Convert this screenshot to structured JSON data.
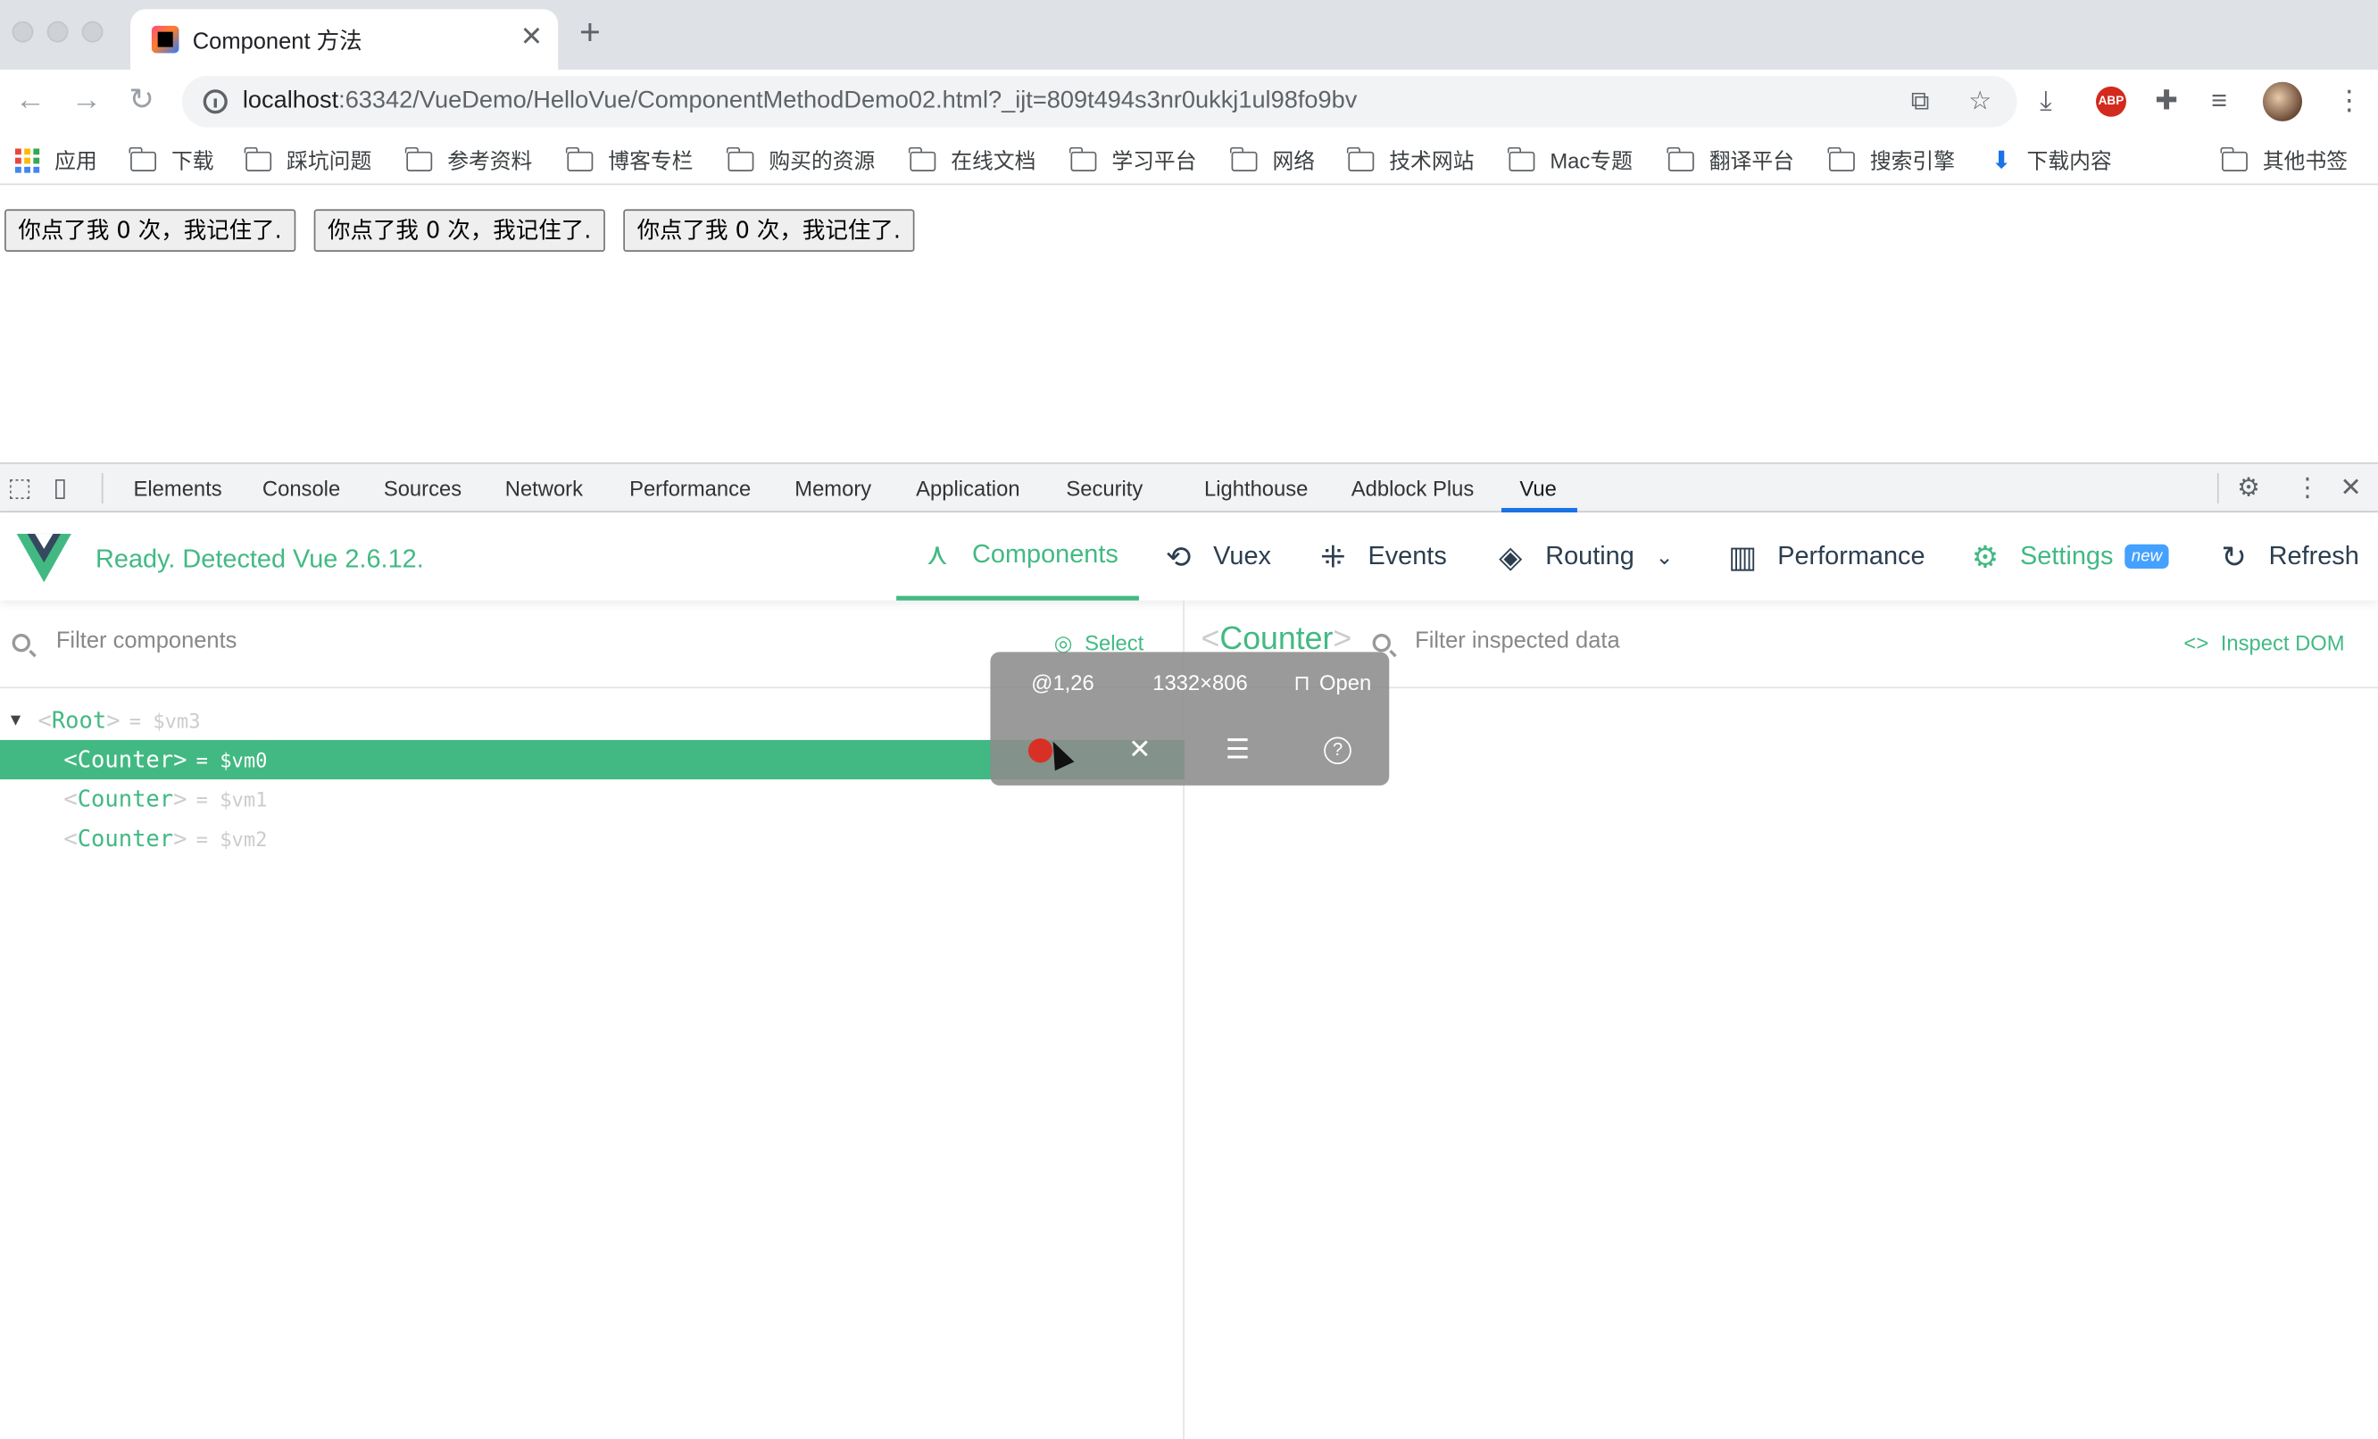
{
  "browser": {
    "tab_title": "Component 方法",
    "url_host": "localhost",
    "url_path": ":63342/VueDemo/HelloVue/ComponentMethodDemo02.html?_ijt=809t494s3nr0ukkj1ul98fo9bv",
    "close_glyph": "✕",
    "new_tab_glyph": "+"
  },
  "bookmarks": [
    {
      "label": "应用",
      "icon": "apps-icon"
    },
    {
      "label": "下载",
      "icon": "folder-icon"
    },
    {
      "label": "踩坑问题",
      "icon": "folder-icon"
    },
    {
      "label": "参考资料",
      "icon": "folder-icon"
    },
    {
      "label": "博客专栏",
      "icon": "folder-icon"
    },
    {
      "label": "购买的资源",
      "icon": "folder-icon"
    },
    {
      "label": "在线文档",
      "icon": "folder-icon"
    },
    {
      "label": "学习平台",
      "icon": "folder-icon"
    },
    {
      "label": "网络",
      "icon": "folder-icon"
    },
    {
      "label": "技术网站",
      "icon": "folder-icon"
    },
    {
      "label": "Mac专题",
      "icon": "folder-icon"
    },
    {
      "label": "翻译平台",
      "icon": "folder-icon"
    },
    {
      "label": "搜索引擎",
      "icon": "folder-icon"
    },
    {
      "label": "下载内容",
      "icon": "download-icon"
    },
    {
      "label": "其他书签",
      "icon": "folder-icon"
    }
  ],
  "page": {
    "buttons": [
      "你点了我 0 次，我记住了.",
      "你点了我 0 次，我记住了.",
      "你点了我 0 次，我记住了."
    ]
  },
  "devtools": {
    "tabs": [
      "Elements",
      "Console",
      "Sources",
      "Network",
      "Performance",
      "Memory",
      "Application",
      "Security",
      "Lighthouse",
      "Adblock Plus",
      "Vue"
    ],
    "active_tab": "Vue"
  },
  "vue": {
    "status": "Ready. Detected Vue 2.6.12.",
    "nav": {
      "components": "Components",
      "vuex": "Vuex",
      "events": "Events",
      "routing": "Routing",
      "performance": "Performance",
      "settings": "Settings",
      "settings_badge": "new",
      "refresh": "Refresh"
    },
    "filter_components_placeholder": "Filter components",
    "select_label": "Select",
    "tree": [
      {
        "tag": "Root",
        "vm": "= $vm3",
        "selected": false
      },
      {
        "tag": "Counter",
        "vm": "= $vm0",
        "selected": true
      },
      {
        "tag": "Counter",
        "vm": "= $vm1",
        "selected": false
      },
      {
        "tag": "Counter",
        "vm": "= $vm2",
        "selected": false
      }
    ],
    "inspected_name": "Counter",
    "filter_data_placeholder": "Filter inspected data",
    "inspect_dom_label": "Inspect DOM"
  },
  "overlay": {
    "position": "@1,26",
    "size": "1332×806",
    "open_label": "Open",
    "close_glyph": "✕",
    "help_glyph": "?"
  },
  "colors": {
    "vue_green": "#42b983",
    "record_red": "#d93025",
    "badge_blue": "#44a1ff"
  }
}
